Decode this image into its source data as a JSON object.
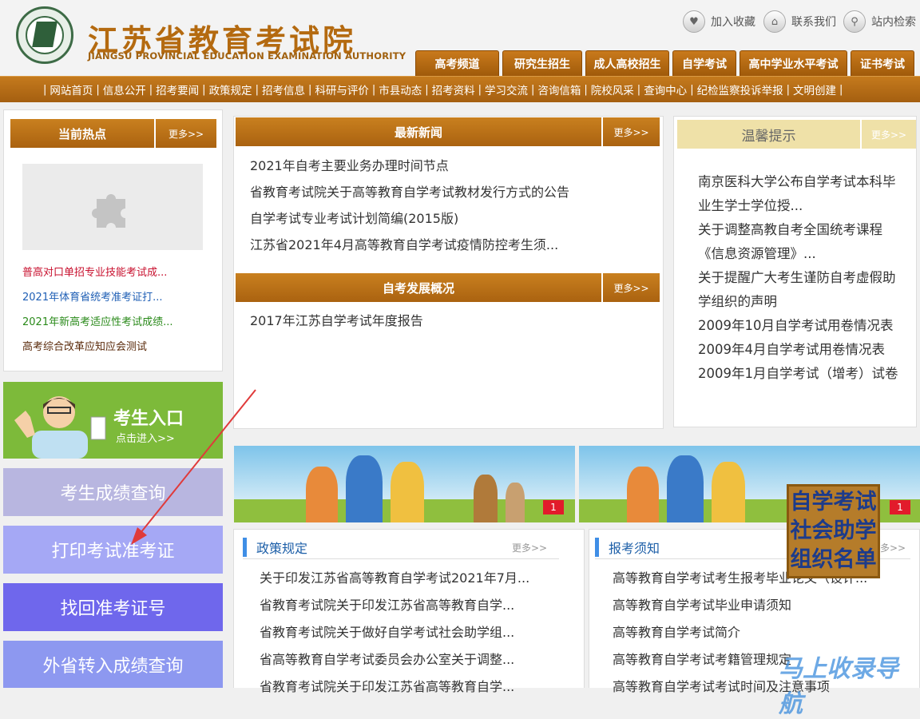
{
  "header": {
    "title": "江苏省教育考试院",
    "subtitle": "JIANGSU PROVINCIAL EDUCATION EXAMINATION AUTHORITY",
    "tools": [
      "加入收藏",
      "联系我们",
      "站内检索"
    ],
    "tabs": [
      "高考频道",
      "研究生招生",
      "成人高校招生",
      "自学考试",
      "高中学业水平考试",
      "证书考试"
    ]
  },
  "nav": [
    "网站首页",
    "信息公开",
    "招考要闻",
    "政策规定",
    "招考信息",
    "科研与评价",
    "市县动态",
    "招考资料",
    "学习交流",
    "咨询信箱",
    "院校风采",
    "查询中心",
    "纪检监察投诉举报",
    "文明创建"
  ],
  "hot": {
    "title": "当前热点",
    "more": "更多>>",
    "links": [
      {
        "text": "普高对口单招专业技能考试成...",
        "color": "#c8102e"
      },
      {
        "text": "2021年体育省统考准考证打...",
        "color": "#1f5fb5"
      },
      {
        "text": "2021年新高考适应性考试成绩...",
        "color": "#2a8a1a"
      },
      {
        "text": "高考综合改革应知应会测试",
        "color": "#5a2a0a"
      }
    ]
  },
  "sidebar": {
    "entry_title": "考生入口",
    "entry_sub": "点击进入>>",
    "buttons": [
      {
        "label": "考生成绩查询",
        "bg": "#b8b6e0"
      },
      {
        "label": "打印考试准考证",
        "bg": "#a5a8f5"
      },
      {
        "label": "找回准考证号",
        "bg": "#6f67ec"
      },
      {
        "label": "外省转入成绩查询",
        "bg": "#8d98f0"
      }
    ]
  },
  "news": {
    "title": "最新新闻",
    "more": "更多>>",
    "items": [
      "2021年自考主要业务办理时间节点",
      "省教育考试院关于高等教育自学考试教材发行方式的公告",
      "自学考试专业考试计划简编(2015版)",
      "江苏省2021年4月高等教育自学考试疫情防控考生须..."
    ]
  },
  "overview": {
    "title": "自考发展概况",
    "more": "更多>>",
    "items": [
      "2017年江苏自学考试年度报告"
    ]
  },
  "tips": {
    "title": "温馨提示",
    "more": "更多>>",
    "items": [
      "南京医科大学公布自学考试本科毕",
      "业生学士学位授...",
      "关于调整高教自考全国统考课程",
      "《信息资源管理》...",
      "关于提醒广大考生谨防自考虚假助",
      "学组织的声明",
      "2009年10月自学考试用卷情况表",
      "2009年4月自学考试用卷情况表",
      "2009年1月自学考试（增考）试卷"
    ]
  },
  "banner_badge": "1",
  "policy": {
    "title": "政策规定",
    "more": "更多>>",
    "items": [
      "关于印发江苏省高等教育自学考试2021年7月...",
      "省教育考试院关于印发江苏省高等教育自学...",
      "省教育考试院关于做好自学考试社会助学组...",
      "省高等教育自学考试委员会办公室关于调整...",
      "省教育考试院关于印发江苏省高等教育自学..."
    ]
  },
  "notice": {
    "title": "报考须知",
    "more": "更多>>",
    "items": [
      "高等教育自学考试考生报考毕业论文（设计...",
      "高等教育自学考试毕业申请须知",
      "高等教育自学考试简介",
      "高等教育自学考试考籍管理规定",
      "高等教育自学考试考试时间及注意事项"
    ]
  },
  "ad": [
    "自学考试",
    "社会助学",
    "组织名单"
  ],
  "watermark": "马上收录导航",
  "colors": {
    "brand": "#b46a10",
    "nav": "#b06810",
    "arrow": "#e03a3a"
  }
}
